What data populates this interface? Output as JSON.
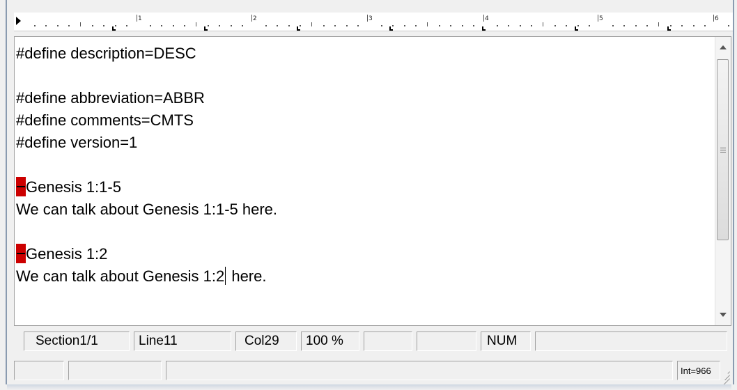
{
  "ruler": {
    "numbers": [
      "1",
      "2",
      "3",
      "4",
      "5",
      "6"
    ]
  },
  "editor": {
    "lines": [
      {
        "text": "#define description=DESC"
      },
      {
        "text": ""
      },
      {
        "text": "#define abbreviation=ABBR"
      },
      {
        "text": "#define comments=CMTS"
      },
      {
        "text": "#define version=1"
      },
      {
        "text": ""
      },
      {
        "text": "Genesis 1:1-5",
        "marker": true
      },
      {
        "text": "We can talk about Genesis 1:1-5 here."
      },
      {
        "text": ""
      },
      {
        "text": "Genesis 1:2",
        "marker": true
      },
      {
        "text_before": "We can talk about Genesis 1:2",
        "text_after": " here.",
        "caret": true
      }
    ],
    "marker_color": "#cc0000"
  },
  "status": {
    "section": "Section1/1",
    "line": "Line11",
    "col": "Col29",
    "zoom": "100 %",
    "num": "NUM",
    "int_label": "Int=966"
  }
}
